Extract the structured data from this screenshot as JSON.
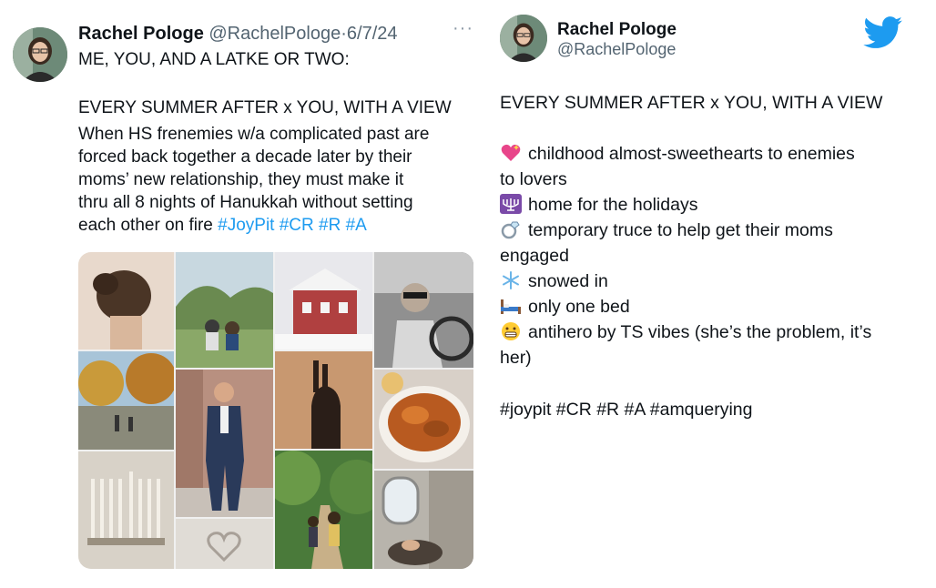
{
  "left_tweet": {
    "author_name": "Rachel Pologe",
    "author_handle": "@RachelPologe",
    "separator": "·",
    "date": "6/7/24",
    "more_icon": "···",
    "line1": "ME, YOU, AND A LATKE OR TWO:",
    "line2": "EVERY SUMMER AFTER x YOU, WITH A VIEW",
    "para": [
      "When HS frenemies w/a complicated past are",
      "forced back together a decade later by their",
      "moms’ new relationship, they must make it",
      "thru all 8 nights of Hanukkah without setting"
    ],
    "last_line_text": "each other on fire ",
    "hashtags": "#JoyPit #CR #R #A",
    "collage_icon": "photo-collage"
  },
  "right_tweet": {
    "author_name": "Rachel Pologe",
    "author_handle": "@RachelPologe",
    "platform_icon": "twitter-bird-icon",
    "title": "EVERY SUMMER AFTER x YOU, WITH A VIEW",
    "items": [
      {
        "icon": "sparkling-heart-icon",
        "line1": "childhood almost-sweethearts to enemies",
        "line2": "to lovers"
      },
      {
        "icon": "menorah-icon",
        "line1": "home for the holidays",
        "line2": ""
      },
      {
        "icon": "ring-icon",
        "line1": "temporary truce to help get their moms",
        "line2": "engaged"
      },
      {
        "icon": "snowflake-icon",
        "line1": "snowed in",
        "line2": ""
      },
      {
        "icon": "bed-icon",
        "line1": "only one bed",
        "line2": ""
      },
      {
        "icon": "grimacing-face-icon",
        "line1": "antihero by TS vibes (she’s the problem, it’s",
        "line2": "her)"
      }
    ],
    "hashtags": "#joypit #CR #R #A #amquerying"
  },
  "colors": {
    "link": "#1d9bf0",
    "twitter_blue": "#1d9bf0",
    "muted": "#536471"
  }
}
